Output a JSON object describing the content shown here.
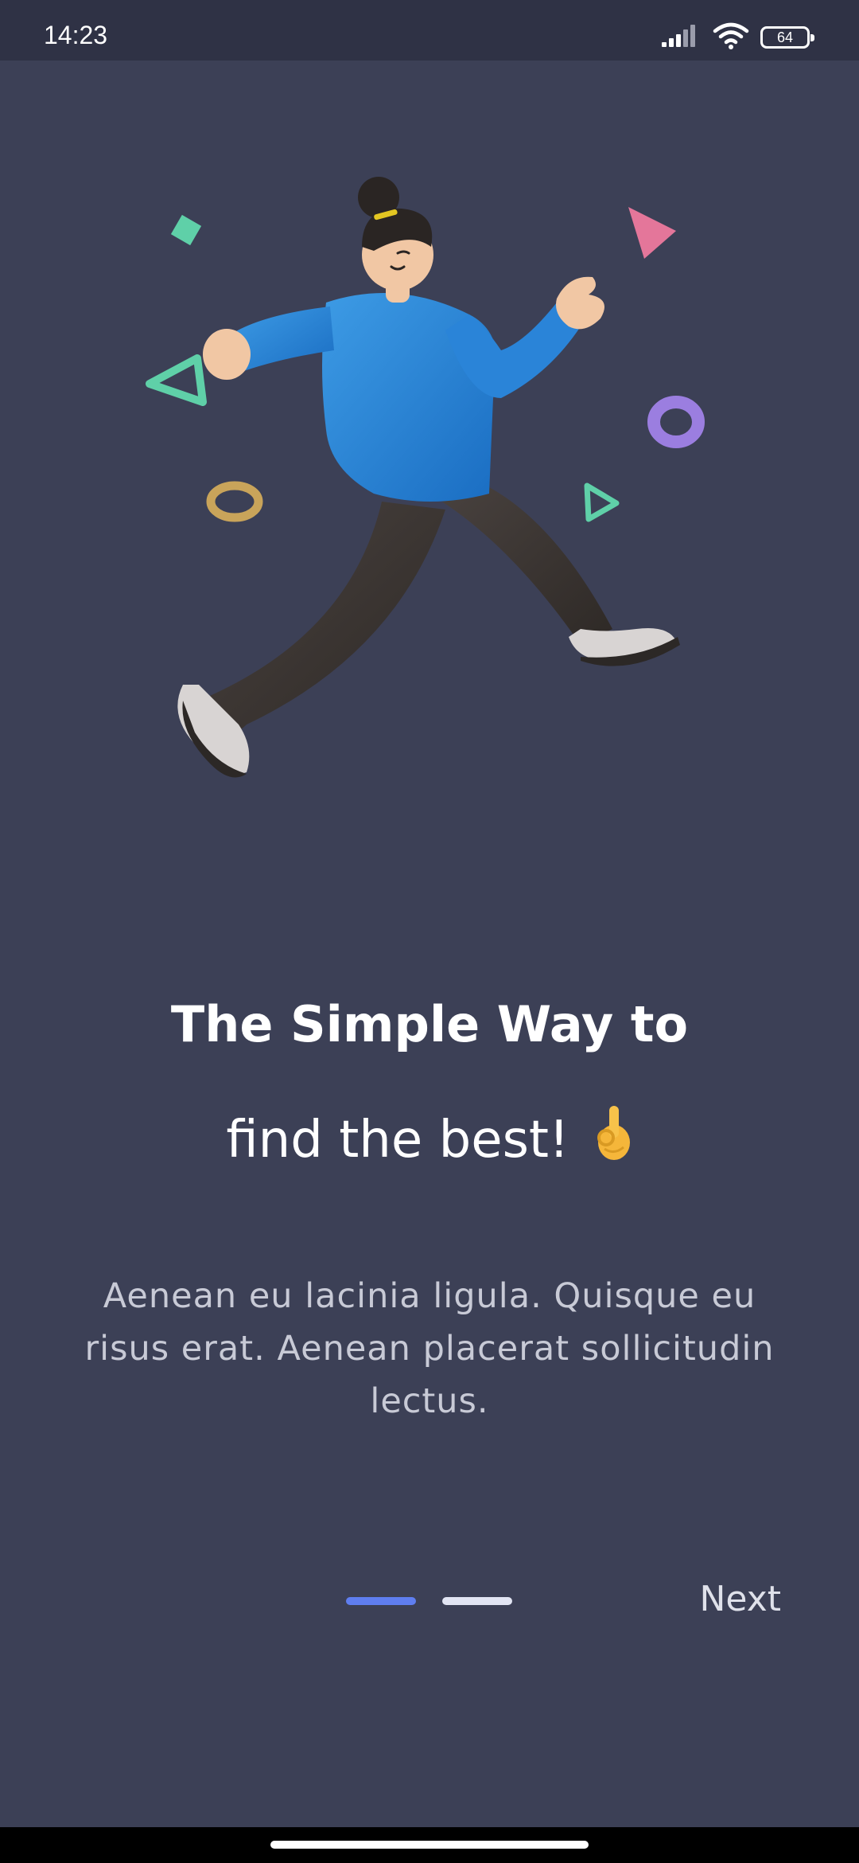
{
  "status_bar": {
    "time": "14:23",
    "battery": "64",
    "icons": [
      "signal-icon",
      "wifi-icon",
      "battery-icon"
    ]
  },
  "illustration": {
    "name": "running-person-illustration"
  },
  "onboarding": {
    "title_line1": "The Simple Way to",
    "title_line2": "find the best!",
    "title_emoji_icon": "ok-hand-icon",
    "description": "Aenean eu lacinia ligula. Quisque eu risus erat. Aenean placerat sollicitudin lectus.",
    "pager": {
      "pages": 2,
      "active_index": 0
    },
    "next_label": "Next"
  },
  "colors": {
    "background": "#3c4056",
    "status_bar": "#2f3245",
    "accent": "#5f7ef0",
    "inactive_dot": "#e2e5f3"
  }
}
